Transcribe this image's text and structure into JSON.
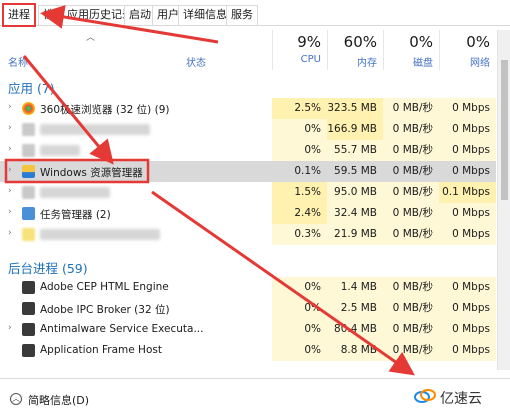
{
  "tabs": [
    "进程",
    "性能",
    "应用历史记录",
    "启动",
    "用户",
    "详细信息",
    "服务"
  ],
  "header": {
    "name_label": "名称",
    "status_label": "状态",
    "cpu": {
      "pct": "9%",
      "label": "CPU"
    },
    "memory": {
      "pct": "60%",
      "label": "内存"
    },
    "disk": {
      "pct": "0%",
      "label": "磁盘"
    },
    "network": {
      "pct": "0%",
      "label": "网络"
    }
  },
  "groups": {
    "apps": "应用 (7)",
    "background": "后台进程 (59)"
  },
  "rows": [
    {
      "name": "360极速浏览器 (32 位) (9)",
      "cpu": "2.5%",
      "mem": "323.5 MB",
      "disk": "0 MB/秒",
      "net": "0 Mbps",
      "icon": "chrome-icon"
    },
    {
      "name": "",
      "cpu": "0%",
      "mem": "166.9 MB",
      "disk": "0 MB/秒",
      "net": "0 Mbps",
      "icon": "blurred-icon"
    },
    {
      "name": "",
      "cpu": "0%",
      "mem": "55.7 MB",
      "disk": "0 MB/秒",
      "net": "0 Mbps",
      "icon": "blurred-icon"
    },
    {
      "name": "Windows 资源管理器",
      "cpu": "0.1%",
      "mem": "59.5 MB",
      "disk": "0 MB/秒",
      "net": "0 Mbps",
      "icon": "folder-icon"
    },
    {
      "name": "",
      "cpu": "1.5%",
      "mem": "95.0 MB",
      "disk": "0 MB/秒",
      "net": "0.1 Mbps",
      "icon": "blurred-icon"
    },
    {
      "name": "任务管理器 (2)",
      "cpu": "2.4%",
      "mem": "32.4 MB",
      "disk": "0 MB/秒",
      "net": "0 Mbps",
      "icon": "task-manager-icon"
    },
    {
      "name": "",
      "cpu": "0.3%",
      "mem": "21.9 MB",
      "disk": "0 MB/秒",
      "net": "0 Mbps",
      "icon": "blurred-icon"
    },
    {
      "name": "Adobe CEP HTML Engine",
      "cpu": "0%",
      "mem": "1.4 MB",
      "disk": "0 MB/秒",
      "net": "0 Mbps",
      "icon": "app-window-icon"
    },
    {
      "name": "Adobe IPC Broker (32 位)",
      "cpu": "0%",
      "mem": "2.5 MB",
      "disk": "0 MB/秒",
      "net": "0 Mbps",
      "icon": "app-window-icon"
    },
    {
      "name": "Antimalware Service Executa...",
      "cpu": "0%",
      "mem": "80.4 MB",
      "disk": "0 MB/秒",
      "net": "0 Mbps",
      "icon": "app-window-icon"
    },
    {
      "name": "Application Frame Host",
      "cpu": "0%",
      "mem": "8.8 MB",
      "disk": "0 MB/秒",
      "net": "0 Mbps",
      "icon": "app-window-icon"
    }
  ],
  "footer": {
    "fewer_details": "简略信息(D)",
    "watermark": "亿速云"
  },
  "colors": {
    "accent_blue": "#1e6fba",
    "annotation_red": "#e53935",
    "heat_light": "#fff8d6",
    "heat_dark": "#fff1b0"
  }
}
